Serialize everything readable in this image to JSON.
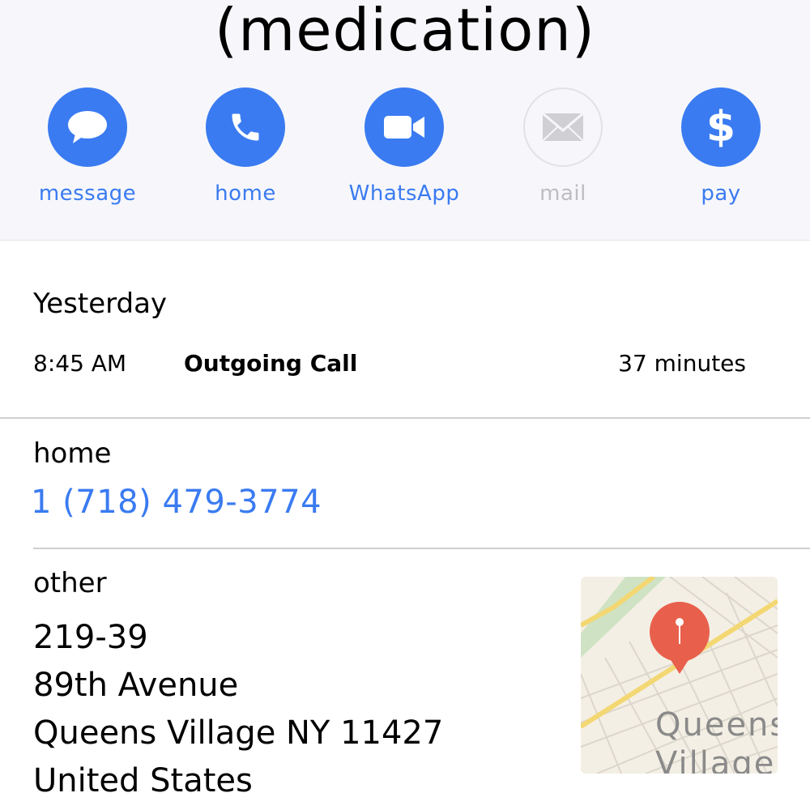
{
  "contact": {
    "name": "(medication)"
  },
  "actions": [
    {
      "label": "message",
      "icon": "message-bubble-icon",
      "enabled": true
    },
    {
      "label": "home",
      "icon": "phone-icon",
      "enabled": true
    },
    {
      "label": "WhatsApp",
      "icon": "video-camera-icon",
      "enabled": true
    },
    {
      "label": "mail",
      "icon": "envelope-icon",
      "enabled": false
    },
    {
      "label": "pay",
      "icon": "dollar-icon",
      "enabled": true
    }
  ],
  "recent": {
    "day": "Yesterday",
    "time": "8:45 AM",
    "type": "Outgoing Call",
    "duration": "37 minutes"
  },
  "phone": {
    "label": "home",
    "number": "1 (718) 479-3774"
  },
  "address": {
    "label": "other",
    "lines": [
      "219-39",
      "89th Avenue",
      "Queens Village NY 11427",
      "United States"
    ],
    "map_label_line1": "Queens",
    "map_label_line2": "Village"
  },
  "colors": {
    "accent": "#3a7bf1",
    "disabled": "#bdbdc2",
    "pin": "#e8604c"
  }
}
